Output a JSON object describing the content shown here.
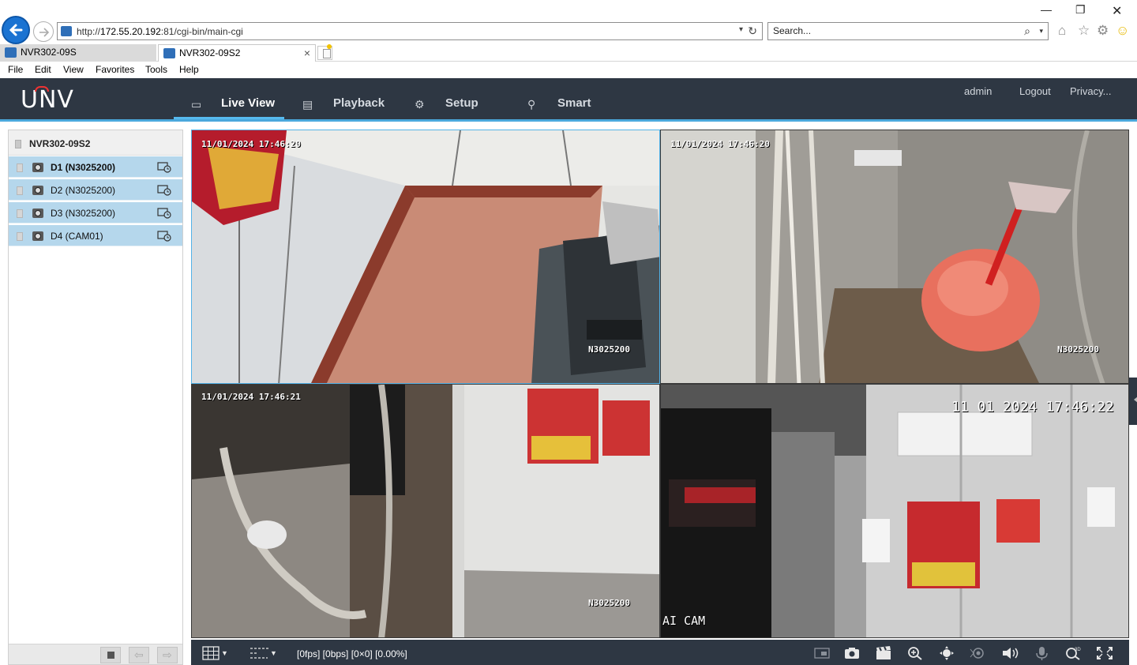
{
  "browser": {
    "url_prefix": "http://",
    "url_host": "172.55.20.192",
    "url_rest": ":81/cgi-bin/main-cgi",
    "search_placeholder": "Search...",
    "tabs": [
      {
        "label": "NVR302-09S"
      },
      {
        "label": "NVR302-09S2"
      }
    ],
    "menu": [
      "File",
      "Edit",
      "View",
      "Favorites",
      "Tools",
      "Help"
    ],
    "toolbar_icons": [
      "home-icon",
      "star-icon",
      "gear-icon",
      "smiley-icon"
    ]
  },
  "app": {
    "logo": "UNV",
    "nav": [
      {
        "label": "Live View",
        "icon": "monitor-icon",
        "active": true
      },
      {
        "label": "Playback",
        "icon": "film-icon",
        "active": false
      },
      {
        "label": "Setup",
        "icon": "gear-icon",
        "active": false
      },
      {
        "label": "Smart",
        "icon": "person-icon",
        "active": false
      }
    ],
    "header_links": {
      "user": "admin",
      "logout": "Logout",
      "privacy": "Privacy..."
    },
    "accent": "#4ba8dc",
    "header_bg": "#2e3743"
  },
  "sidebar": {
    "device": "NVR302-09S2",
    "channels": [
      {
        "label": "D1 (N3025200)",
        "selected": true
      },
      {
        "label": "D2 (N3025200)",
        "selected": false
      },
      {
        "label": "D3 (N3025200)",
        "selected": false
      },
      {
        "label": "D4 (CAM01)",
        "selected": false
      }
    ]
  },
  "tiles": [
    {
      "timestamp": "11/01/2024 17:46:20",
      "name": "N3025200",
      "scene": "atm-booth"
    },
    {
      "timestamp": "11/01/2024 17:46:20",
      "name": "N3025200",
      "scene": "utility-corner"
    },
    {
      "timestamp": "11/01/2024 17:46:21",
      "name": "N3025200",
      "scene": "street-door"
    },
    {
      "timestamp": "11  01  2024  17:46:22",
      "name": "AI CAM",
      "scene": "atm-lobby"
    }
  ],
  "status_bar": {
    "stream_info": "[0fps] [0bps] [0×0] [0.00%]"
  }
}
